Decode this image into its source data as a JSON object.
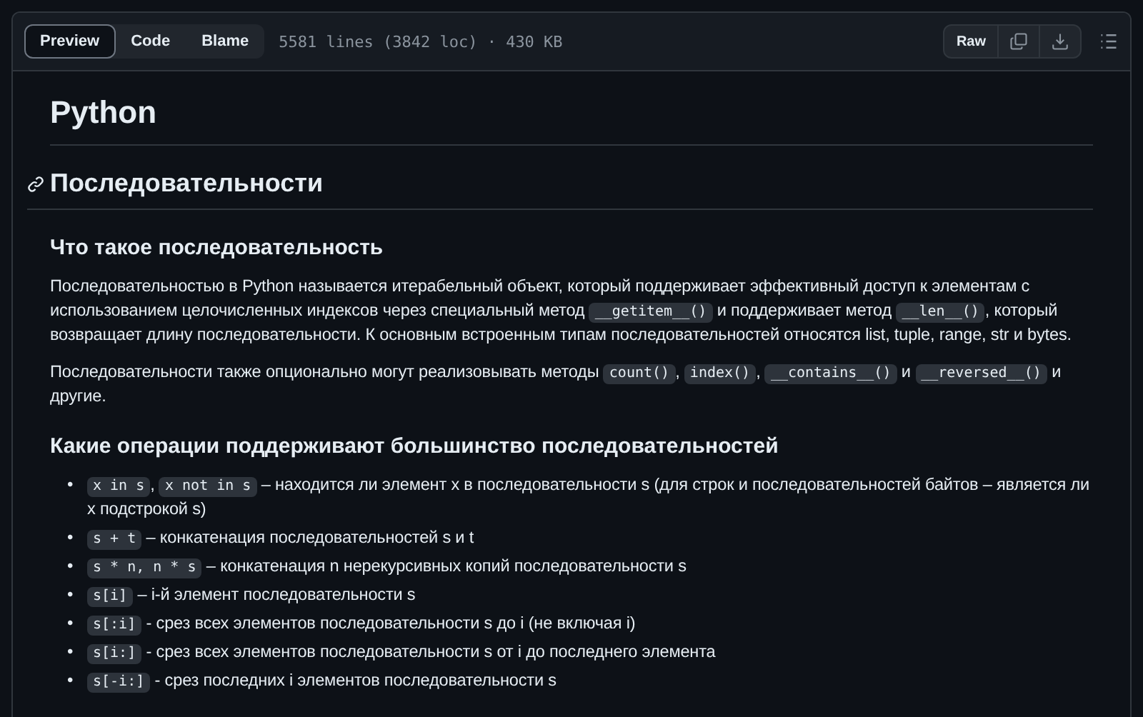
{
  "toolbar": {
    "tabs": [
      {
        "label": "Preview",
        "selected": true
      },
      {
        "label": "Code",
        "selected": false
      },
      {
        "label": "Blame",
        "selected": false
      }
    ],
    "file_info": "5581 lines (3842 loc) · 430 KB",
    "raw_button": "Raw"
  },
  "document": {
    "title": "Python",
    "section_heading": "Последовательности",
    "subheading_1": "Что такое последовательность",
    "paragraphs": [
      [
        {
          "kind": "text",
          "text": "Последовательностью в Python называется итерабельный объект, который поддерживает эффективный доступ к элементам с использованием целочисленных индексов через специальный метод "
        },
        {
          "kind": "code",
          "text": "__getitem__()"
        },
        {
          "kind": "text",
          "text": " и поддерживает метод "
        },
        {
          "kind": "code",
          "text": "__len__()"
        },
        {
          "kind": "text",
          "text": ", который возвращает длину последовательности. К основным встроенным типам последовательностей относятся list, tuple, range, str и bytes."
        }
      ],
      [
        {
          "kind": "text",
          "text": "Последовательности также опционально могут реализовывать методы "
        },
        {
          "kind": "code",
          "text": "count()"
        },
        {
          "kind": "text",
          "text": ", "
        },
        {
          "kind": "code",
          "text": "index()"
        },
        {
          "kind": "text",
          "text": ", "
        },
        {
          "kind": "code",
          "text": "__contains__()"
        },
        {
          "kind": "text",
          "text": " и "
        },
        {
          "kind": "code",
          "text": "__reversed__()"
        },
        {
          "kind": "text",
          "text": " и другие."
        }
      ]
    ],
    "subheading_2": "Какие операции поддерживают большинство последовательностей",
    "list_bullet": "•",
    "list": [
      [
        {
          "kind": "code",
          "text": "x in s"
        },
        {
          "kind": "text",
          "text": ", "
        },
        {
          "kind": "code",
          "text": "x not in s"
        },
        {
          "kind": "text",
          "text": " – находится ли элемент x в последовательности s (для строк и последовательностей байтов – является ли x подстрокой s)"
        }
      ],
      [
        {
          "kind": "code",
          "text": "s + t"
        },
        {
          "kind": "text",
          "text": " – конкатенация последовательностей s и t"
        }
      ],
      [
        {
          "kind": "code",
          "text": "s * n, n * s"
        },
        {
          "kind": "text",
          "text": " – конкатенация n нерекурсивных копий последовательности s"
        }
      ],
      [
        {
          "kind": "code",
          "text": "s[i]"
        },
        {
          "kind": "text",
          "text": " – i-й элемент последовательности s"
        }
      ],
      [
        {
          "kind": "code",
          "text": "s[:i]"
        },
        {
          "kind": "text",
          "text": " - срез всех элементов последовательности s до i (не включая i)"
        }
      ],
      [
        {
          "kind": "code",
          "text": "s[i:]"
        },
        {
          "kind": "text",
          "text": " - срез всех элементов последовательности s от i до последнего элемента"
        }
      ],
      [
        {
          "kind": "code",
          "text": "s[-i:]"
        },
        {
          "kind": "text",
          "text": " - срез последних i элементов последовательности s"
        }
      ]
    ]
  }
}
